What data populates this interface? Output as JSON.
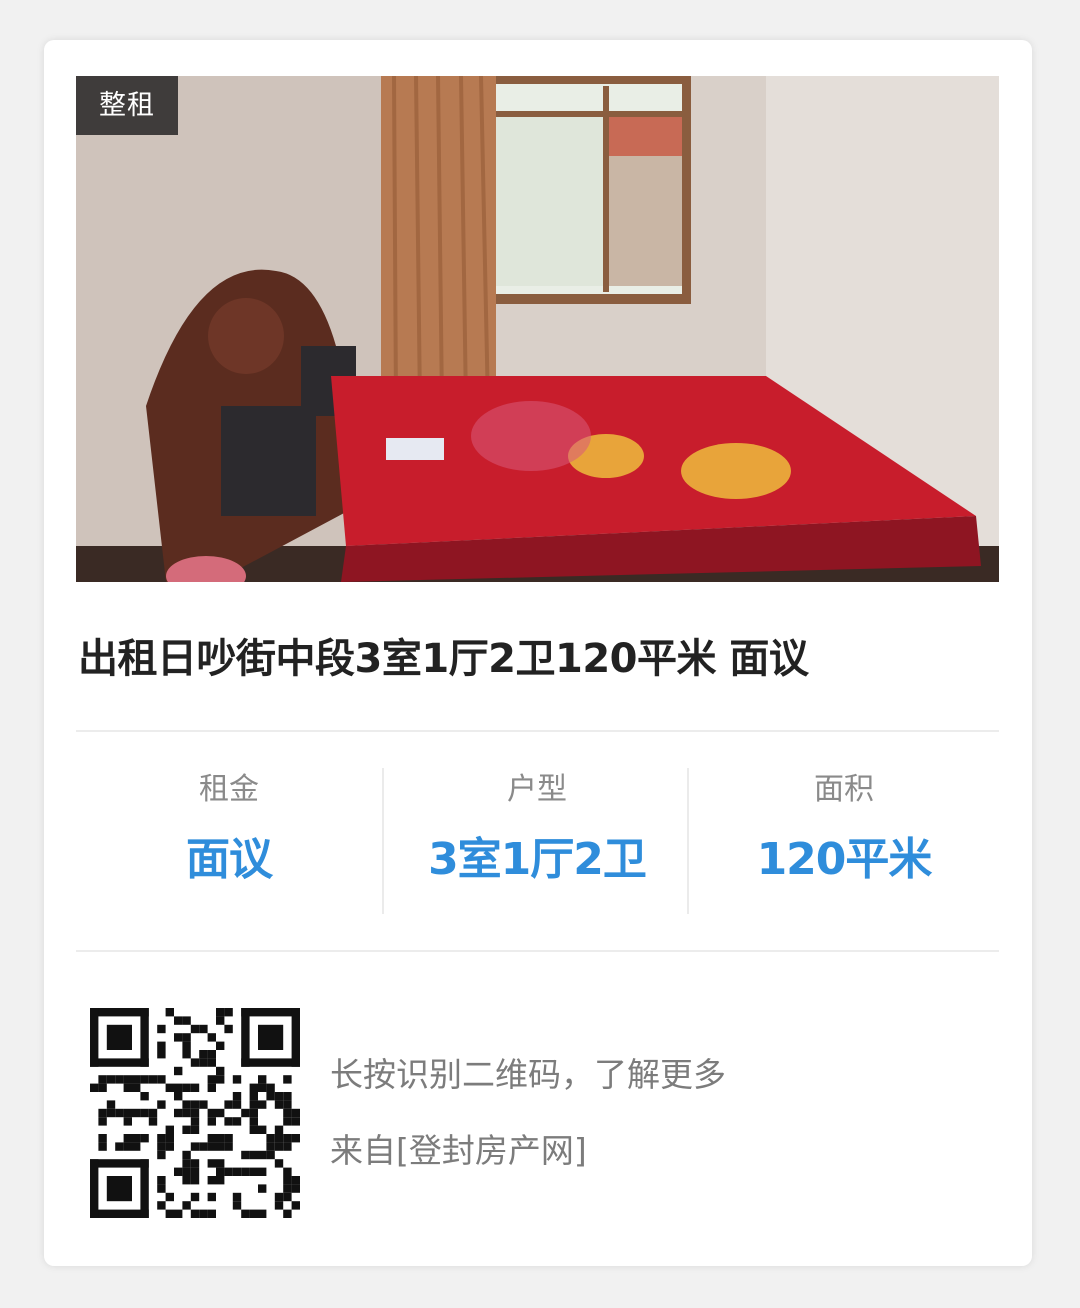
{
  "listing": {
    "tag": "整租",
    "title": "出租日吵街中段3室1厅2卫120平米 面议",
    "photo_icon": "bedroom-photo"
  },
  "stats": [
    {
      "label": "租金",
      "value": "面议"
    },
    {
      "label": "户型",
      "value": "3室1厅2卫"
    },
    {
      "label": "面积",
      "value": "120平米"
    }
  ],
  "footer": {
    "qr_icon": "qr-code-icon",
    "hint": "长按识别二维码，了解更多",
    "source": "来自[登封房产网]"
  },
  "colors": {
    "accent": "#2f8ddb",
    "title": "#222222",
    "muted": "#8a8a8a",
    "tag_bg": "#1e1e1e"
  }
}
